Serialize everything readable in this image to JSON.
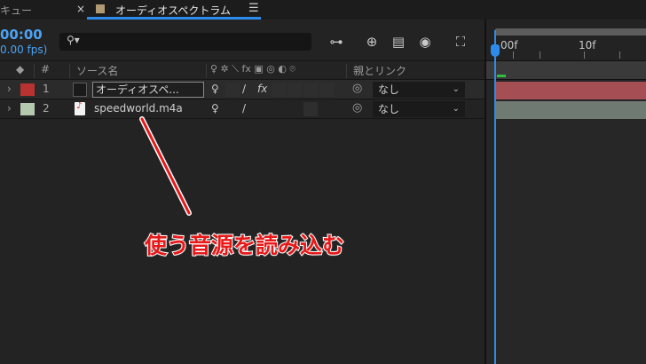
{
  "tabs": {
    "left_label": "キュー",
    "close_glyph": "×",
    "active_title": "オーディオスペクトラム",
    "menu_glyph": "☰"
  },
  "comp": {
    "timecode": "00:00",
    "fps": "0.00 fps)",
    "search_icon": "⚲▾",
    "tools": [
      "⊶",
      "⊕",
      "▤",
      "◉",
      "⛶"
    ]
  },
  "columns": {
    "label_icon": "◆",
    "number": "#",
    "source_name": "ソース名",
    "switches": "♀ ✲ ⟍ fx ▣ ◎ ◐ ⌾",
    "parent_link": "親とリンク"
  },
  "layers": [
    {
      "number": "1",
      "name": "オーディオスペ...",
      "color": "#b83232",
      "shy_icon": "♀",
      "quality_icon": "/",
      "fx_icon": "fx",
      "parent_icon": "◎",
      "parent": "なし",
      "twirl": "›",
      "chevron": "⌄"
    },
    {
      "number": "2",
      "name": "speedworld.m4a",
      "color": "#b5c8b0",
      "shy_icon": "♀",
      "quality_icon": "/",
      "parent_icon": "◎",
      "parent": "なし",
      "twirl": "›",
      "chevron": "⌄"
    }
  ],
  "timeline": {
    "ruler_start": "00f",
    "ruler_mark": "10f",
    "accent_color": "#2d8ceb"
  },
  "annotation": {
    "text": "使う音源を読み込む",
    "color": "#e81818"
  }
}
